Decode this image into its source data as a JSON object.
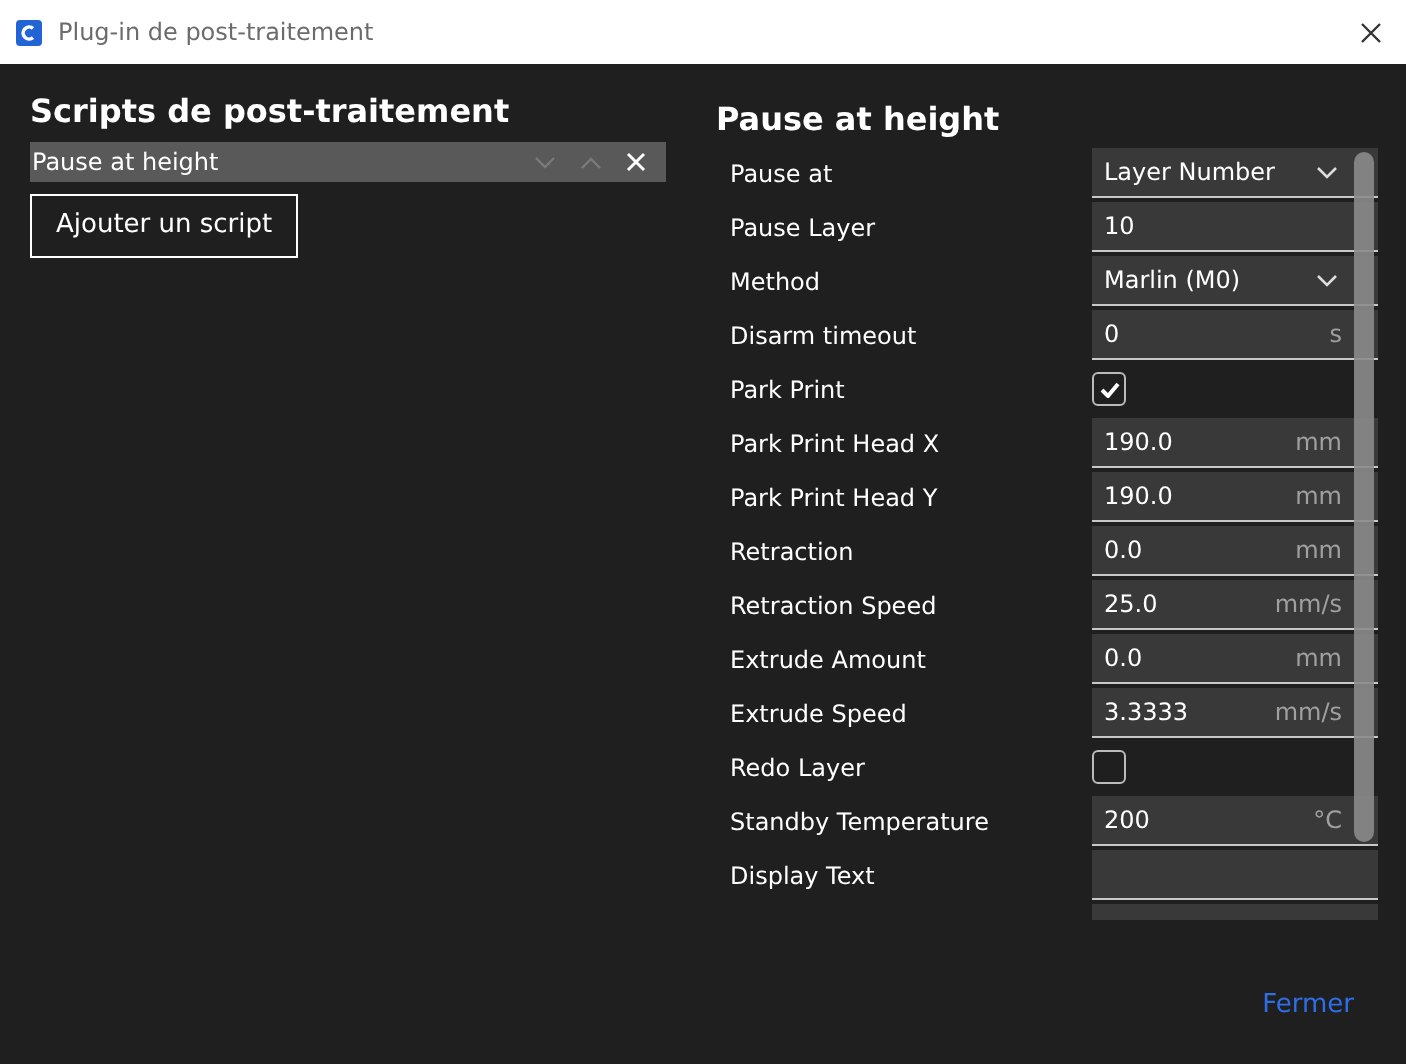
{
  "window": {
    "title": "Plug-in de post-traitement"
  },
  "scripts_panel": {
    "heading": "Scripts de post-traitement",
    "scripts": [
      {
        "name": "Pause at height",
        "selected": true
      }
    ],
    "add_button": "Ajouter un script"
  },
  "settings_panel": {
    "heading": "Pause at height",
    "settings": [
      {
        "kind": "select",
        "label": "Pause at",
        "value": "Layer Number"
      },
      {
        "kind": "number",
        "label": "Pause Layer",
        "value": "10"
      },
      {
        "kind": "select",
        "label": "Method",
        "value": "Marlin (M0)"
      },
      {
        "kind": "number",
        "label": "Disarm timeout",
        "value": "0",
        "unit": "s"
      },
      {
        "kind": "checkbox",
        "label": "Park Print",
        "checked": true
      },
      {
        "kind": "number",
        "label": "Park Print Head X",
        "value": "190.0",
        "unit": "mm"
      },
      {
        "kind": "number",
        "label": "Park Print Head Y",
        "value": "190.0",
        "unit": "mm"
      },
      {
        "kind": "number",
        "label": "Retraction",
        "value": "0.0",
        "unit": "mm"
      },
      {
        "kind": "number",
        "label": "Retraction Speed",
        "value": "25.0",
        "unit": "mm/s"
      },
      {
        "kind": "number",
        "label": "Extrude Amount",
        "value": "0.0",
        "unit": "mm"
      },
      {
        "kind": "number",
        "label": "Extrude Speed",
        "value": "3.3333",
        "unit": "mm/s"
      },
      {
        "kind": "checkbox",
        "label": "Redo Layer",
        "checked": false
      },
      {
        "kind": "number",
        "label": "Standby Temperature",
        "value": "200",
        "unit": "°C"
      },
      {
        "kind": "text",
        "label": "Display Text"
      }
    ]
  },
  "buttons": [
    "Fermer"
  ]
}
